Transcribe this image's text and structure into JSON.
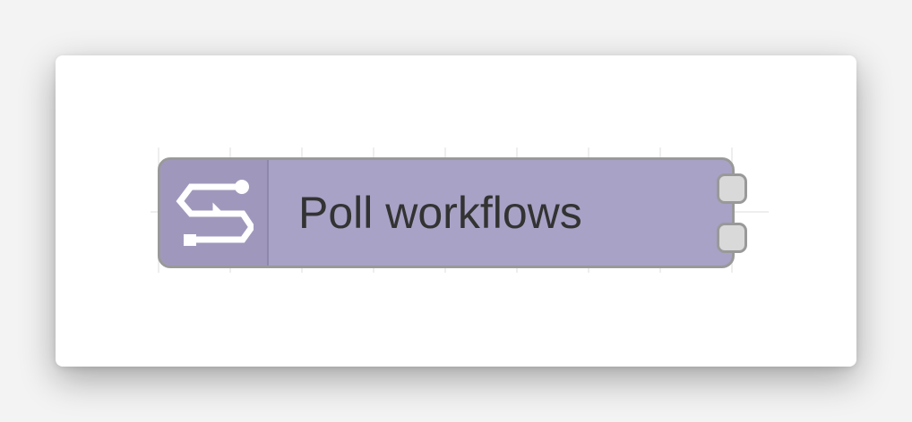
{
  "node": {
    "label": "Poll workflows",
    "icon": "workflow-switch-icon",
    "colors": {
      "body": "#a8a2c6",
      "icon_area": "#a098bc",
      "border": "#999999",
      "port": "#d9d9d9",
      "text": "#333333"
    },
    "output_ports": 2
  }
}
